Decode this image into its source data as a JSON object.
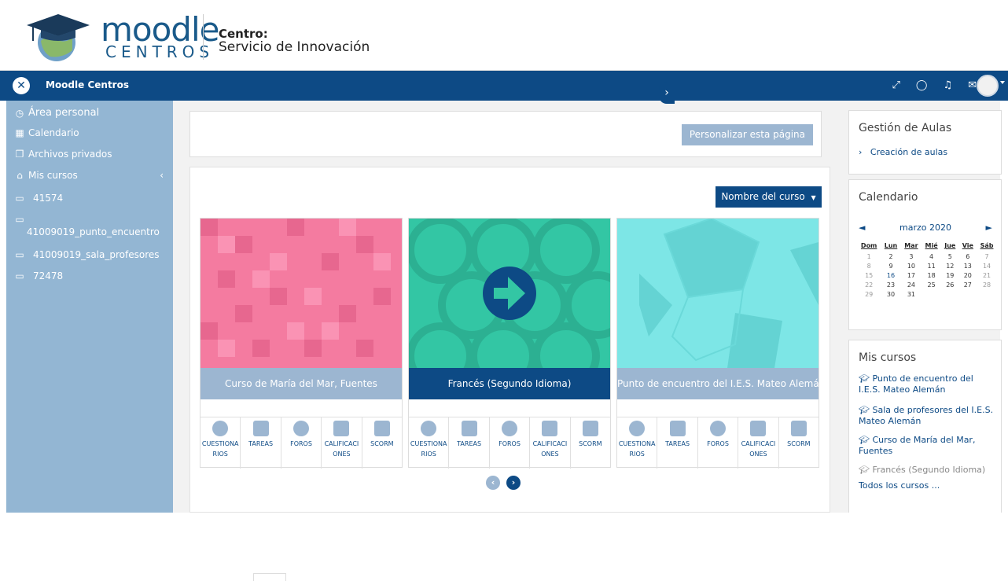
{
  "header": {
    "logo_text": "moodle",
    "logo_sub": "CENTROS",
    "centro_label": "Centro:",
    "centro_name": "Servicio de Innovación"
  },
  "navbar": {
    "title": "Moodle Centros",
    "icons": [
      "expand-icon",
      "chat-icon",
      "bell-icon",
      "mail-icon"
    ]
  },
  "sidebar": {
    "items": [
      {
        "label": "Área personal",
        "icon": "gauge-icon"
      },
      {
        "label": "Calendario",
        "icon": "calendar-icon"
      },
      {
        "label": "Archivos privados",
        "icon": "files-icon"
      },
      {
        "label": "Mis cursos",
        "icon": "graduation-icon"
      },
      {
        "label": "41574",
        "icon": "folder-icon"
      },
      {
        "label": "41009019_punto_encuentro",
        "icon": "folder-icon"
      },
      {
        "label": "41009019_sala_profesores",
        "icon": "folder-icon"
      },
      {
        "label": "72478",
        "icon": "folder-icon"
      }
    ]
  },
  "main": {
    "customize_button": "Personalizar esta página",
    "sort_button": "Nombre del curso",
    "courses": [
      {
        "title": "Curso de María del Mar, Fuentes",
        "color": "#f47ba0",
        "title_bg": "#9cb6d1"
      },
      {
        "title": "Francés (Segundo Idioma)",
        "color": "#33c6a4",
        "title_bg": "#0d4a85"
      },
      {
        "title": "Punto de encuentro del I.E.S. Mateo Alemán",
        "color": "#7de6e6",
        "title_bg": "#9cb6d1"
      }
    ],
    "activities": [
      {
        "line1": "CUESTIONA",
        "line2": "RIOS"
      },
      {
        "line1": "TAREAS",
        "line2": ""
      },
      {
        "line1": "FOROS",
        "line2": ""
      },
      {
        "line1": "CALIFICACI",
        "line2": "ONES"
      },
      {
        "line1": "SCORM",
        "line2": ""
      }
    ]
  },
  "right": {
    "gestion": {
      "title": "Gestión de Aulas",
      "link": "Creación de aulas"
    },
    "calendar": {
      "title": "Calendario",
      "month": "marzo 2020",
      "days": [
        "Dom",
        "Lun",
        "Mar",
        "Mié",
        "Jue",
        "Vie",
        "Sáb"
      ],
      "weeks": [
        [
          "1",
          "2",
          "3",
          "4",
          "5",
          "6",
          "7"
        ],
        [
          "8",
          "9",
          "10",
          "11",
          "12",
          "13",
          "14"
        ],
        [
          "15",
          "16",
          "17",
          "18",
          "19",
          "20",
          "21"
        ],
        [
          "22",
          "23",
          "24",
          "25",
          "26",
          "27",
          "28"
        ],
        [
          "29",
          "30",
          "31",
          "",
          "",
          "",
          ""
        ]
      ]
    },
    "mis_cursos": {
      "title": "Mis cursos",
      "items": [
        "Punto de encuentro del I.E.S. Mateo Alemán",
        "Sala de profesores del I.E.S. Mateo Alemán",
        "Curso de María del Mar, Fuentes",
        "Francés (Segundo Idioma)"
      ],
      "all_link": "Todos los cursos ..."
    }
  }
}
